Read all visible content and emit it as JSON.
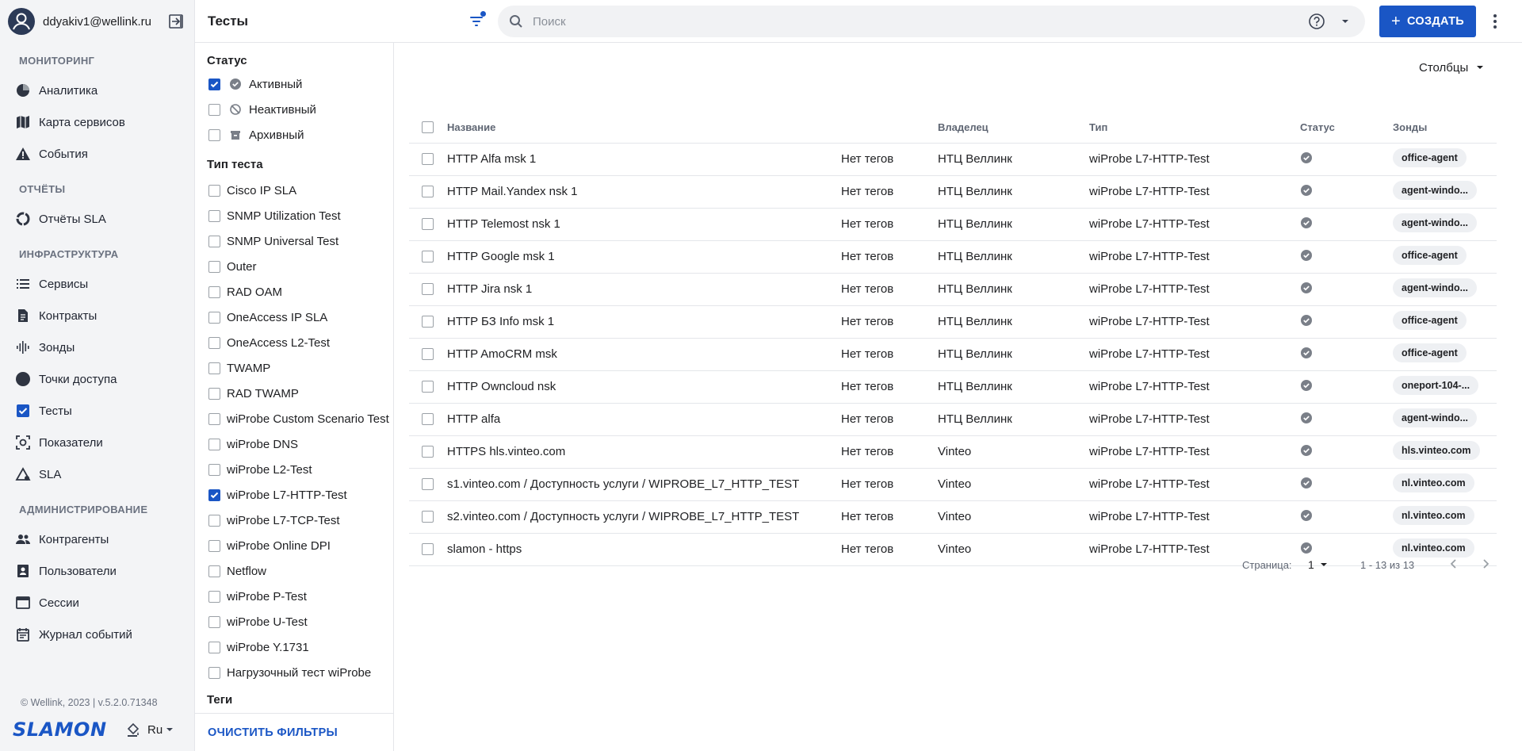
{
  "user": {
    "email": "ddyakiv1@wellink.ru"
  },
  "nav": {
    "sections": [
      {
        "title": "МОНИТОРИНГ",
        "items": [
          {
            "label": "Аналитика",
            "icon": "pie-chart-icon"
          },
          {
            "label": "Карта сервисов",
            "icon": "map-icon"
          },
          {
            "label": "События",
            "icon": "warning-icon"
          }
        ]
      },
      {
        "title": "ОТЧЁТЫ",
        "items": [
          {
            "label": "Отчёты SLA",
            "icon": "report-ring-icon"
          }
        ]
      },
      {
        "title": "ИНФРАСТРУКТУРА",
        "items": [
          {
            "label": "Сервисы",
            "icon": "list-icon"
          },
          {
            "label": "Контракты",
            "icon": "document-icon"
          },
          {
            "label": "Зонды",
            "icon": "signal-bars-icon"
          },
          {
            "label": "Точки доступа",
            "icon": "access-point-icon"
          },
          {
            "label": "Тесты",
            "icon": "checkbox-icon"
          },
          {
            "label": "Показатели",
            "icon": "metrics-icon"
          },
          {
            "label": "SLA",
            "icon": "sla-icon"
          }
        ]
      },
      {
        "title": "АДМИНИСТРИРОВАНИЕ",
        "items": [
          {
            "label": "Контрагенты",
            "icon": "people-icon"
          },
          {
            "label": "Пользователи",
            "icon": "user-badge-icon"
          },
          {
            "label": "Сессии",
            "icon": "window-icon"
          },
          {
            "label": "Журнал событий",
            "icon": "calendar-log-icon"
          }
        ]
      }
    ]
  },
  "footer": {
    "version": "© Wellink, 2023 | v.5.2.0.71348",
    "logo": "SLAMON",
    "language": "Ru"
  },
  "header": {
    "title": "Тесты",
    "search_placeholder": "Поиск",
    "create_label": "СОЗДАТЬ"
  },
  "filters": {
    "status_title": "Статус",
    "status": [
      {
        "label": "Активный",
        "checked": true
      },
      {
        "label": "Неактивный",
        "checked": false
      },
      {
        "label": "Архивный",
        "checked": false
      }
    ],
    "type_title": "Тип теста",
    "types": [
      {
        "label": "Cisco IP SLA",
        "checked": false
      },
      {
        "label": "SNMP Utilization Test",
        "checked": false
      },
      {
        "label": "SNMP Universal Test",
        "checked": false
      },
      {
        "label": "Outer",
        "checked": false
      },
      {
        "label": "RAD OAM",
        "checked": false
      },
      {
        "label": "OneAccess IP SLA",
        "checked": false
      },
      {
        "label": "OneAccess L2-Test",
        "checked": false
      },
      {
        "label": "TWAMP",
        "checked": false
      },
      {
        "label": "RAD TWAMP",
        "checked": false
      },
      {
        "label": "wiProbe Custom Scenario Test",
        "checked": false
      },
      {
        "label": "wiProbe DNS",
        "checked": false
      },
      {
        "label": "wiProbe L2-Test",
        "checked": false
      },
      {
        "label": "wiProbe L7-HTTP-Test",
        "checked": true
      },
      {
        "label": "wiProbe L7-TCP-Test",
        "checked": false
      },
      {
        "label": "wiProbe Online DPI",
        "checked": false
      },
      {
        "label": "Netflow",
        "checked": false
      },
      {
        "label": "wiProbe P-Test",
        "checked": false
      },
      {
        "label": "wiProbe U-Test",
        "checked": false
      },
      {
        "label": "wiProbe Y.1731",
        "checked": false
      },
      {
        "label": "Нагрузочный тест wiProbe",
        "checked": false
      }
    ],
    "tags_title": "Теги",
    "clear_label": "ОЧИСТИТЬ ФИЛЬТРЫ"
  },
  "table": {
    "columns_button": "Столбцы",
    "headers": {
      "name": "Название",
      "owner": "Владелец",
      "type": "Тип",
      "status": "Статус",
      "zones": "Зонды"
    },
    "rows": [
      {
        "name": "HTTP Alfa msk 1",
        "tags": "Нет тегов",
        "owner": "НТЦ Веллинк",
        "type": "wiProbe L7-HTTP-Test",
        "zone": "office-agent"
      },
      {
        "name": "HTTP Mail.Yandex nsk 1",
        "tags": "Нет тегов",
        "owner": "НТЦ Веллинк",
        "type": "wiProbe L7-HTTP-Test",
        "zone": "agent-windo..."
      },
      {
        "name": "HTTP Telemost nsk 1",
        "tags": "Нет тегов",
        "owner": "НТЦ Веллинк",
        "type": "wiProbe L7-HTTP-Test",
        "zone": "agent-windo..."
      },
      {
        "name": "HTTP Google msk 1",
        "tags": "Нет тегов",
        "owner": "НТЦ Веллинк",
        "type": "wiProbe L7-HTTP-Test",
        "zone": "office-agent"
      },
      {
        "name": "HTTP Jira nsk 1",
        "tags": "Нет тегов",
        "owner": "НТЦ Веллинк",
        "type": "wiProbe L7-HTTP-Test",
        "zone": "agent-windo..."
      },
      {
        "name": "HTTP БЗ Info msk 1",
        "tags": "Нет тегов",
        "owner": "НТЦ Веллинк",
        "type": "wiProbe L7-HTTP-Test",
        "zone": "office-agent"
      },
      {
        "name": "HTTP AmoCRM msk",
        "tags": "Нет тегов",
        "owner": "НТЦ Веллинк",
        "type": "wiProbe L7-HTTP-Test",
        "zone": "office-agent"
      },
      {
        "name": "HTTP Owncloud nsk",
        "tags": "Нет тегов",
        "owner": "НТЦ Веллинк",
        "type": "wiProbe L7-HTTP-Test",
        "zone": "oneport-104-..."
      },
      {
        "name": "HTTP alfa",
        "tags": "Нет тегов",
        "owner": "НТЦ Веллинк",
        "type": "wiProbe L7-HTTP-Test",
        "zone": "agent-windo..."
      },
      {
        "name": "HTTPS hls.vinteo.com",
        "tags": "Нет тегов",
        "owner": "Vinteo",
        "type": "wiProbe L7-HTTP-Test",
        "zone": "hls.vinteo.com"
      },
      {
        "name": "s1.vinteo.com / Доступность услуги / WIPROBE_L7_HTTP_TEST",
        "tags": "Нет тегов",
        "owner": "Vinteo",
        "type": "wiProbe L7-HTTP-Test",
        "zone": "nl.vinteo.com"
      },
      {
        "name": "s2.vinteo.com / Доступность услуги / WIPROBE_L7_HTTP_TEST",
        "tags": "Нет тегов",
        "owner": "Vinteo",
        "type": "wiProbe L7-HTTP-Test",
        "zone": "nl.vinteo.com"
      },
      {
        "name": "slamon - https",
        "tags": "Нет тегов",
        "owner": "Vinteo",
        "type": "wiProbe L7-HTTP-Test",
        "zone": "nl.vinteo.com"
      }
    ]
  },
  "pagination": {
    "page_label": "Страница:",
    "page": "1",
    "range": "1 - 13 из 13"
  },
  "colors": {
    "accent": "#1a56c5",
    "sidebar_bg": "#f3f4f6",
    "chip_bg": "#eef0f3",
    "status_icon": "#6b7280"
  }
}
